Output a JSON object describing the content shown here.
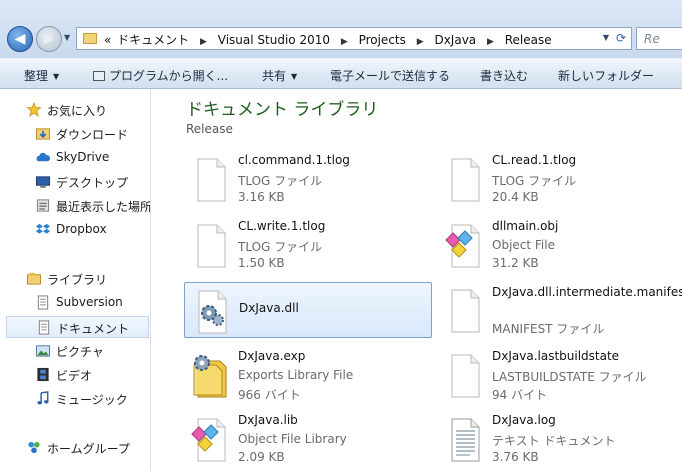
{
  "address": {
    "crumbs": [
      "ドキュメント",
      "Visual Studio 2010",
      "Projects",
      "DxJava",
      "Release"
    ],
    "overflow_glyph": "«",
    "search_placeholder": "Re"
  },
  "toolbar": {
    "organize": "整理",
    "open_with": "プログラムから開く...",
    "share": "共有",
    "email": "電子メールで送信する",
    "burn": "書き込む",
    "new_folder": "新しいフォルダー"
  },
  "nav": {
    "favorites_header": "お気に入り",
    "favorites": [
      "ダウンロード",
      "SkyDrive",
      "デスクトップ",
      "最近表示した場所",
      "Dropbox"
    ],
    "libraries_header": "ライブラリ",
    "libraries": [
      "Subversion",
      "ドキュメント",
      "ピクチャ",
      "ビデオ",
      "ミュージック"
    ],
    "homegroup": "ホームグループ"
  },
  "content": {
    "title": "ドキュメント ライブラリ",
    "subtitle": "Release",
    "files": [
      {
        "name": "cl.command.1.tlog",
        "type": "TLOG ファイル",
        "size": "3.16 KB",
        "icon": "blank-file-icon"
      },
      {
        "name": "CL.read.1.tlog",
        "type": "TLOG ファイル",
        "size": "20.4 KB",
        "icon": "blank-file-icon"
      },
      {
        "name": "CL.write.1.tlog",
        "type": "TLOG ファイル",
        "size": "1.50 KB",
        "icon": "blank-file-icon"
      },
      {
        "name": "dllmain.obj",
        "type": "Object File",
        "size": "31.2 KB",
        "icon": "object-file-icon"
      },
      {
        "name": "DxJava.dll",
        "type": "",
        "size": "",
        "icon": "dll-gear-icon"
      },
      {
        "name": "DxJava.dll.intermediate.manifest",
        "type": "MANIFEST ファイル",
        "size": "",
        "icon": "blank-file-icon"
      },
      {
        "name": "DxJava.exp",
        "type": "Exports Library File",
        "size": "966 バイト",
        "icon": "exports-library-icon"
      },
      {
        "name": "DxJava.lastbuildstate",
        "type": "LASTBUILDSTATE ファイル",
        "size": "94 バイト",
        "icon": "blank-file-icon"
      },
      {
        "name": "DxJava.lib",
        "type": "Object File Library",
        "size": "2.09 KB",
        "icon": "object-file-icon"
      },
      {
        "name": "DxJava.log",
        "type": "テキスト ドキュメント",
        "size": "3.76 KB",
        "icon": "text-document-icon"
      }
    ]
  }
}
